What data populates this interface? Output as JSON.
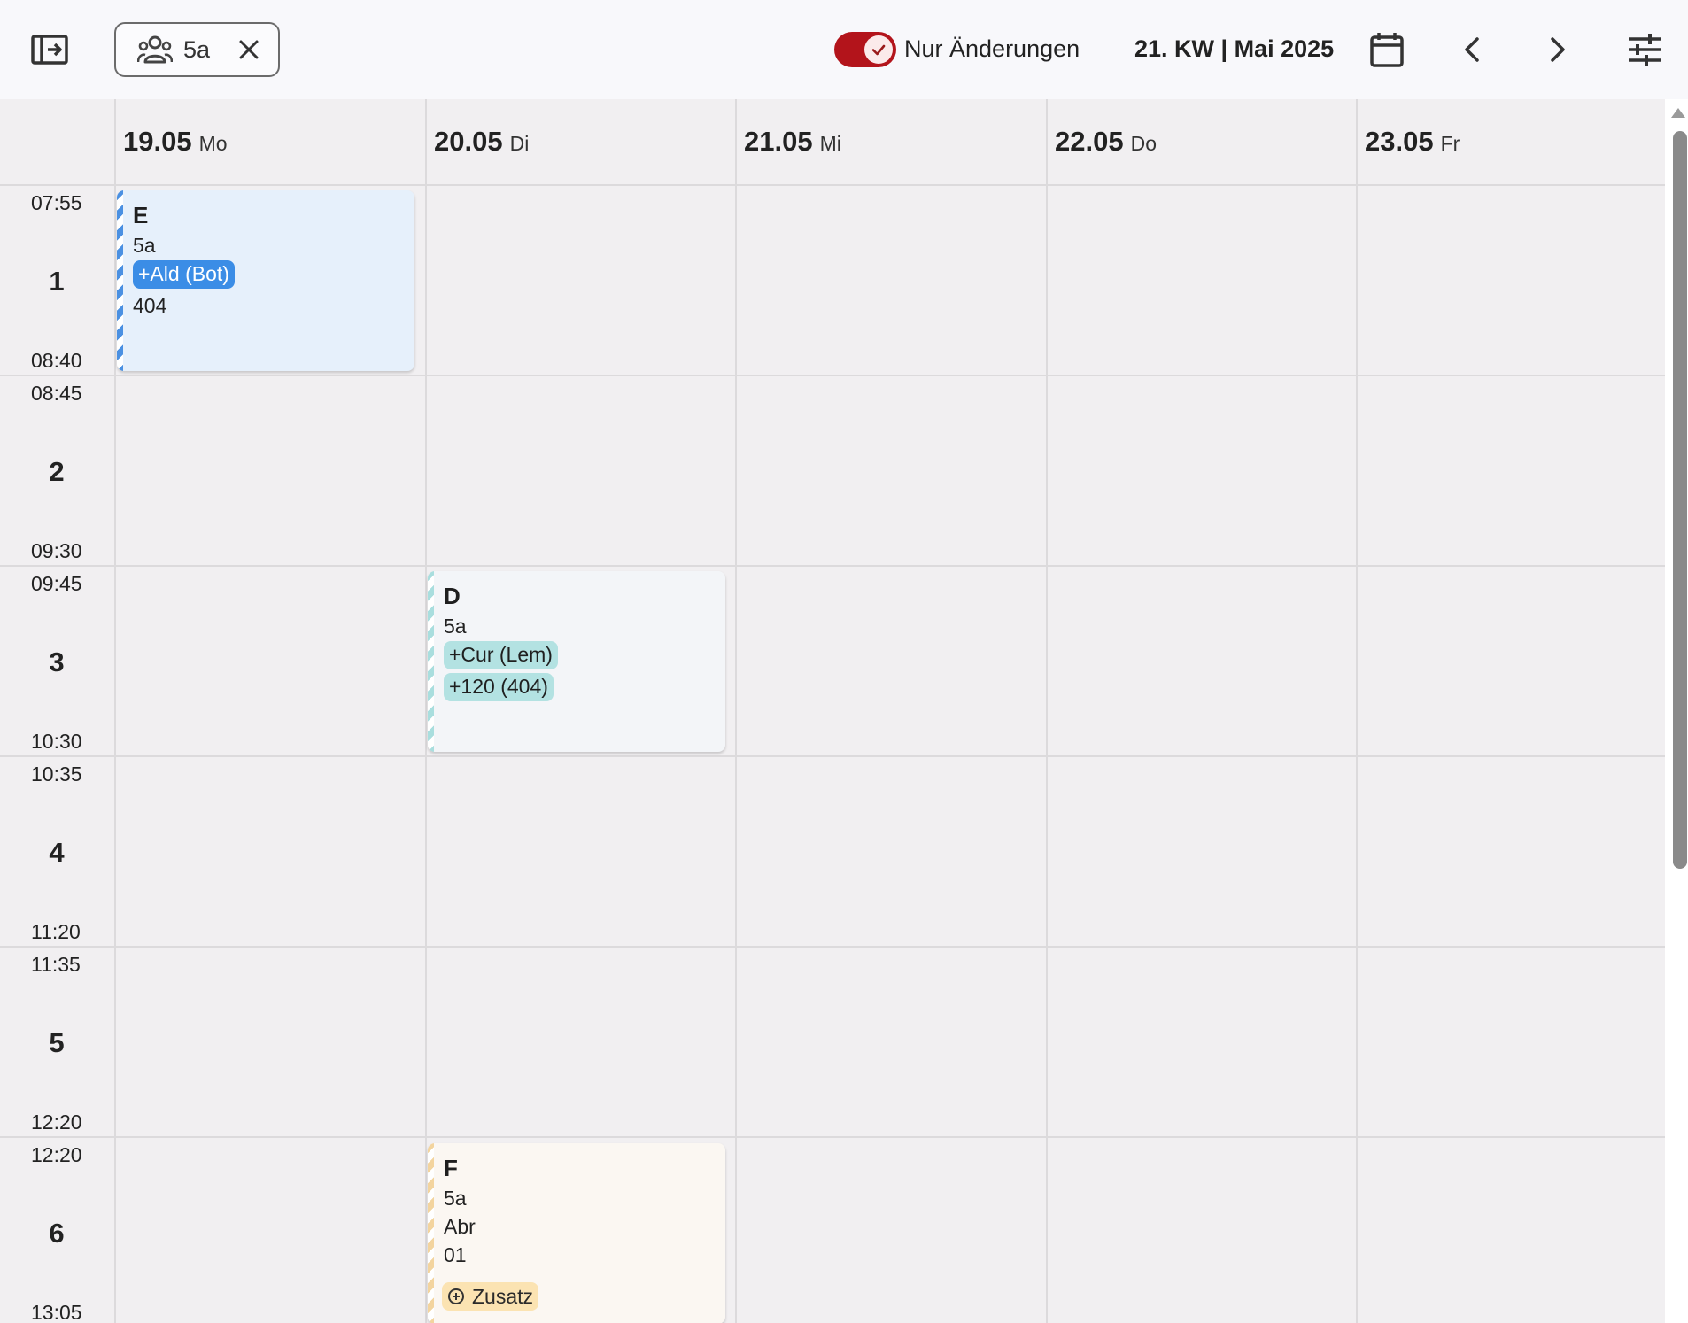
{
  "toolbar": {
    "panel_icon": "panel-toggle-icon",
    "chip_icon": "group-icon",
    "chip_label": "5a",
    "chip_close_icon": "close-icon",
    "only_changes_label": "Nur Änderungen",
    "only_changes_checked": true,
    "week_label": "21. KW | Mai 2025",
    "calendar_icon": "calendar-icon",
    "prev_icon": "chevron-left-icon",
    "next_icon": "chevron-right-icon",
    "settings_icon": "tune-icon",
    "toggle_color": "#b3141b"
  },
  "days": [
    {
      "date": "19.05",
      "dow": "Mo"
    },
    {
      "date": "20.05",
      "dow": "Di"
    },
    {
      "date": "21.05",
      "dow": "Mi"
    },
    {
      "date": "22.05",
      "dow": "Do"
    },
    {
      "date": "23.05",
      "dow": "Fr"
    }
  ],
  "periods": [
    {
      "num": "1",
      "start": "07:55",
      "end": "08:40"
    },
    {
      "num": "2",
      "start": "08:45",
      "end": "09:30"
    },
    {
      "num": "3",
      "start": "09:45",
      "end": "10:30"
    },
    {
      "num": "4",
      "start": "10:35",
      "end": "11:20"
    },
    {
      "num": "5",
      "start": "11:35",
      "end": "12:20"
    },
    {
      "num": "6",
      "start": "12:20",
      "end": "13:05"
    }
  ],
  "events": {
    "e": {
      "subject": "E",
      "class": "5a",
      "teacher_change": "+Ald (Bot)",
      "room": "404"
    },
    "d": {
      "subject": "D",
      "class": "5a",
      "teacher_change": "+Cur (Lem)",
      "room_change": "+120 (404)"
    },
    "f": {
      "subject": "F",
      "class": "5a",
      "teacher": "Abr",
      "room": "01",
      "badge_icon": "add-circle-icon",
      "badge": "Zusatz"
    }
  }
}
